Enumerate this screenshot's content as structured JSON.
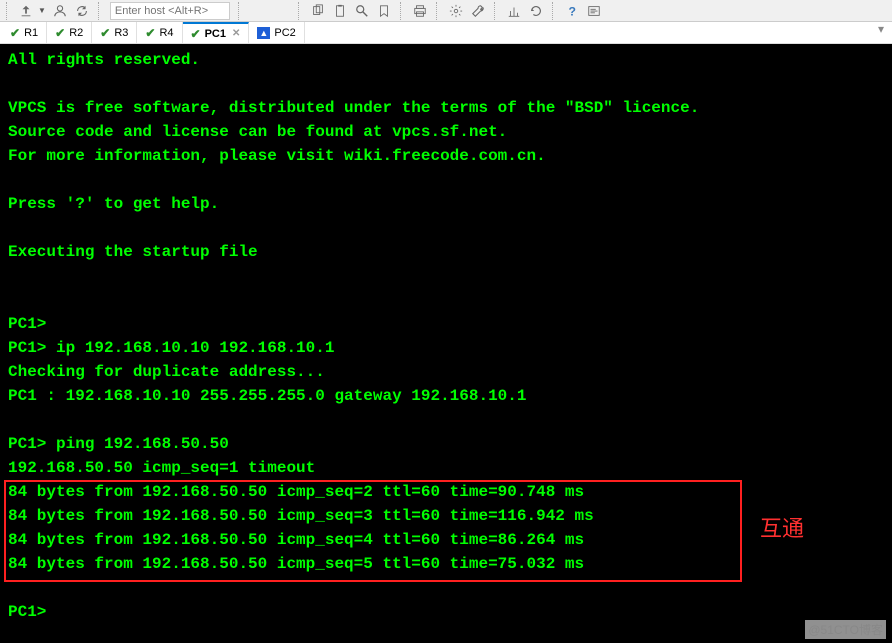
{
  "toolbar": {
    "host_placeholder": "Enter host <Alt+R>"
  },
  "tabs": [
    {
      "label": "R1",
      "icon": "check"
    },
    {
      "label": "R2",
      "icon": "check"
    },
    {
      "label": "R3",
      "icon": "check"
    },
    {
      "label": "R4",
      "icon": "check"
    },
    {
      "label": "PC1",
      "icon": "check",
      "active": true,
      "closable": true
    },
    {
      "label": "PC2",
      "icon": "warn"
    }
  ],
  "terminal": {
    "lines": [
      "All rights reserved.",
      "",
      "VPCS is free software, distributed under the terms of the \"BSD\" licence.",
      "Source code and license can be found at vpcs.sf.net.",
      "For more information, please visit wiki.freecode.com.cn.",
      "",
      "Press '?' to get help.",
      "",
      "Executing the startup file",
      "",
      "",
      "PC1>",
      "PC1> ip 192.168.10.10 192.168.10.1",
      "Checking for duplicate address...",
      "PC1 : 192.168.10.10 255.255.255.0 gateway 192.168.10.1",
      "",
      "PC1> ping 192.168.50.50",
      "192.168.50.50 icmp_seq=1 timeout",
      "84 bytes from 192.168.50.50 icmp_seq=2 ttl=60 time=90.748 ms",
      "84 bytes from 192.168.50.50 icmp_seq=3 ttl=60 time=116.942 ms",
      "84 bytes from 192.168.50.50 icmp_seq=4 ttl=60 time=86.264 ms",
      "84 bytes from 192.168.50.50 icmp_seq=5 ttl=60 time=75.032 ms",
      "",
      "PC1>"
    ]
  },
  "annotation_text": "互通",
  "watermark": "@51CTO博客"
}
